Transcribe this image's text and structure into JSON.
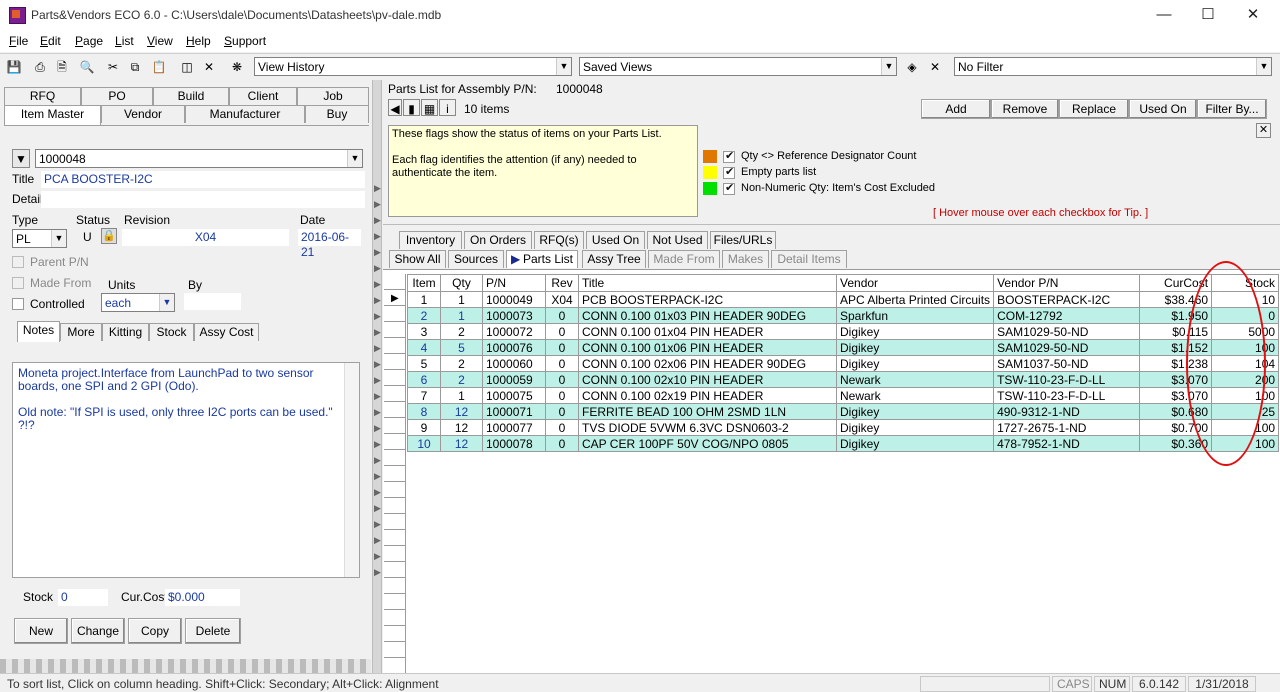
{
  "window": {
    "title": "Parts&Vendors ECO 6.0 - C:\\Users\\dale\\Documents\\Datasheets\\pv-dale.mdb",
    "min": "—",
    "max": "☐",
    "close": "✕"
  },
  "menu": [
    "File",
    "Edit",
    "Page",
    "List",
    "View",
    "Help",
    "Support"
  ],
  "toolbar": {
    "view_history": "View History",
    "saved_views": "Saved Views",
    "filter": "No Filter"
  },
  "left": {
    "tabs_top": [
      "RFQ",
      "PO",
      "Build",
      "Client",
      "Job"
    ],
    "tabs_bottom": [
      "Item Master",
      "Vendor",
      "Manufacturer",
      "Buy"
    ],
    "pn": "1000048",
    "title_label": "Title",
    "title": "PCA BOOSTER-I2C",
    "detail_label": "Detail",
    "type_label": "Type",
    "status_label": "Status",
    "revision_label": "Revision",
    "date_label": "Date",
    "type": "PL",
    "status": "U",
    "revision": "X04",
    "date": "2016-06-21",
    "parent_pn": "Parent P/N",
    "made_from": "Made From",
    "units_label": "Units",
    "by_label": "By",
    "controlled": "Controlled",
    "units": "each",
    "subtabs": [
      "Notes",
      "More",
      "Kitting",
      "Stock",
      "Assy Cost"
    ],
    "notes1": "Moneta project.Interface from LaunchPad to two sensor boards, one SPI and 2 GPI (Odo).",
    "notes2": "Old note: \"If SPI is used, only three I2C ports can be used.\" ?!?",
    "stock_label": "Stock",
    "stock": "0",
    "curcost_label": "Cur.Cost",
    "curcost": "$0.000",
    "buttons": [
      "New",
      "Change",
      "Copy",
      "Delete"
    ]
  },
  "right": {
    "header": "Parts List for Assembly P/N:",
    "header_pn": "1000048",
    "items": "10 items",
    "actions": [
      "Add",
      "Remove",
      "Replace",
      "Used On",
      "Filter By..."
    ],
    "flags_text1": "These flags show the status of items on your Parts List.",
    "flags_text2": "Each flag identifies the attention (if any) needed to authenticate the item.",
    "flags": [
      {
        "label": "Qty <> Reference Designator Count",
        "color": "#e07800"
      },
      {
        "label": "Empty parts list",
        "color": "#ffff00"
      },
      {
        "label": "Non-Numeric Qty: Item's Cost Excluded",
        "color": "#00e000"
      }
    ],
    "tip": "[ Hover mouse over each checkbox for Tip. ]",
    "tabs1": [
      "Inventory",
      "On Orders",
      "RFQ(s)",
      "Used On",
      "Not Used",
      "Files/URLs"
    ],
    "tabs2": [
      "Show All",
      "Sources",
      "Parts List",
      "Assy Tree",
      "Made From",
      "Makes",
      "Detail Items"
    ],
    "columns": [
      "Item",
      "Qty",
      "P/N",
      "Rev",
      "Title",
      "Vendor",
      "Vendor P/N",
      "CurCost",
      "Stock"
    ],
    "rows": [
      [
        "1",
        "1",
        "1000049",
        "X04",
        "PCB BOOSTERPACK-I2C",
        "APC Alberta Printed Circuits",
        "BOOSTERPACK-I2C",
        "$38.460",
        "10"
      ],
      [
        "2",
        "1",
        "1000073",
        "0",
        "CONN 0.100 01x03 PIN HEADER 90DEG",
        "Sparkfun",
        "COM-12792",
        "$1.950",
        "0"
      ],
      [
        "3",
        "2",
        "1000072",
        "0",
        "CONN 0.100 01x04 PIN HEADER",
        "Digikey",
        "SAM1029-50-ND",
        "$0.115",
        "5000"
      ],
      [
        "4",
        "5",
        "1000076",
        "0",
        "CONN 0.100 01x06 PIN HEADER",
        "Digikey",
        "SAM1029-50-ND",
        "$1.152",
        "100"
      ],
      [
        "5",
        "2",
        "1000060",
        "0",
        "CONN 0.100 02x06 PIN HEADER 90DEG",
        "Digikey",
        "SAM1037-50-ND",
        "$1.238",
        "104"
      ],
      [
        "6",
        "2",
        "1000059",
        "0",
        "CONN 0.100 02x10 PIN HEADER",
        "Newark",
        "TSW-110-23-F-D-LL",
        "$3.070",
        "200"
      ],
      [
        "7",
        "1",
        "1000075",
        "0",
        "CONN 0.100 02x19 PIN HEADER",
        "Newark",
        "TSW-110-23-F-D-LL",
        "$3.070",
        "100"
      ],
      [
        "8",
        "12",
        "1000071",
        "0",
        "FERRITE BEAD 100 OHM 2SMD 1LN",
        "Digikey",
        "490-9312-1-ND",
        "$0.680",
        "25"
      ],
      [
        "9",
        "12",
        "1000077",
        "0",
        "TVS DIODE 5VWM 6.3VC DSN0603-2",
        "Digikey",
        "1727-2675-1-ND",
        "$0.700",
        "100"
      ],
      [
        "10",
        "12",
        "1000078",
        "0",
        "CAP CER 100PF 50V COG/NPO 0805",
        "Digikey",
        "478-7952-1-ND",
        "$0.360",
        "100"
      ]
    ]
  },
  "status": {
    "hint": "To sort list, Click on column heading. Shift+Click: Secondary; Alt+Click: Alignment",
    "caps": "CAPS",
    "num": "NUM",
    "version": "6.0.142",
    "date": "1/31/2018"
  }
}
